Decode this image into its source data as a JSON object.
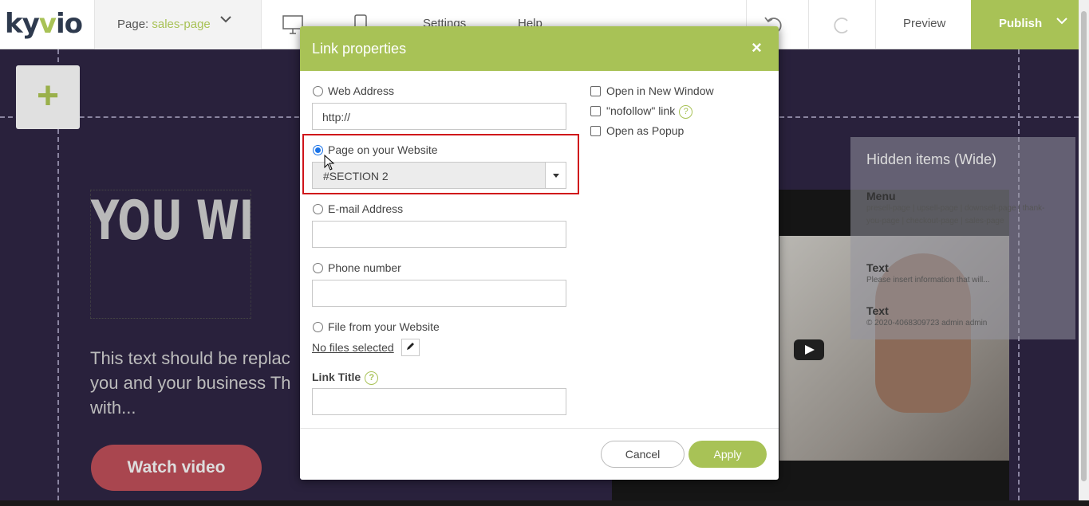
{
  "app": {
    "logo_text_a": "ky",
    "logo_text_b": "v",
    "logo_text_c": "io"
  },
  "topbar": {
    "page_label": "Page:",
    "page_value": "sales-page",
    "settings": "Settings",
    "help": "Help",
    "preview": "Preview",
    "publish": "Publish"
  },
  "canvas": {
    "headline": "YOU WILL LATEST...",
    "body_text": "This text should be replac you and your business Th with...",
    "watch_button": "Watch video",
    "hidden_panel": {
      "title": "Hidden items (Wide)",
      "items": [
        {
          "name": "Menu",
          "detail": "presell-page | upsell-page | downsell-page | thank-you-page | checkout-page | sales-page"
        },
        {
          "name": "Text",
          "detail": "Please insert information that will..."
        },
        {
          "name": "Text",
          "detail": "© 2020-4068309723 admin admin"
        }
      ]
    }
  },
  "modal": {
    "title": "Link properties",
    "close": "×",
    "web_address_label": "Web Address",
    "web_address_value": "http://",
    "page_label": "Page on your Website",
    "page_value": "#SECTION 2",
    "email_label": "E-mail Address",
    "email_value": "",
    "phone_label": "Phone number",
    "phone_value": "",
    "file_label": "File from your Website",
    "no_files": "No files selected",
    "link_title_label": "Link Title",
    "link_title_value": "",
    "new_window": "Open in New Window",
    "nofollow": "\"nofollow\" link",
    "popup": "Open as Popup",
    "help_glyph": "?",
    "cancel": "Cancel",
    "apply": "Apply"
  },
  "colors": {
    "accent": "#a8c256",
    "highlight": "#d0141a",
    "radio": "#1a73e8"
  }
}
